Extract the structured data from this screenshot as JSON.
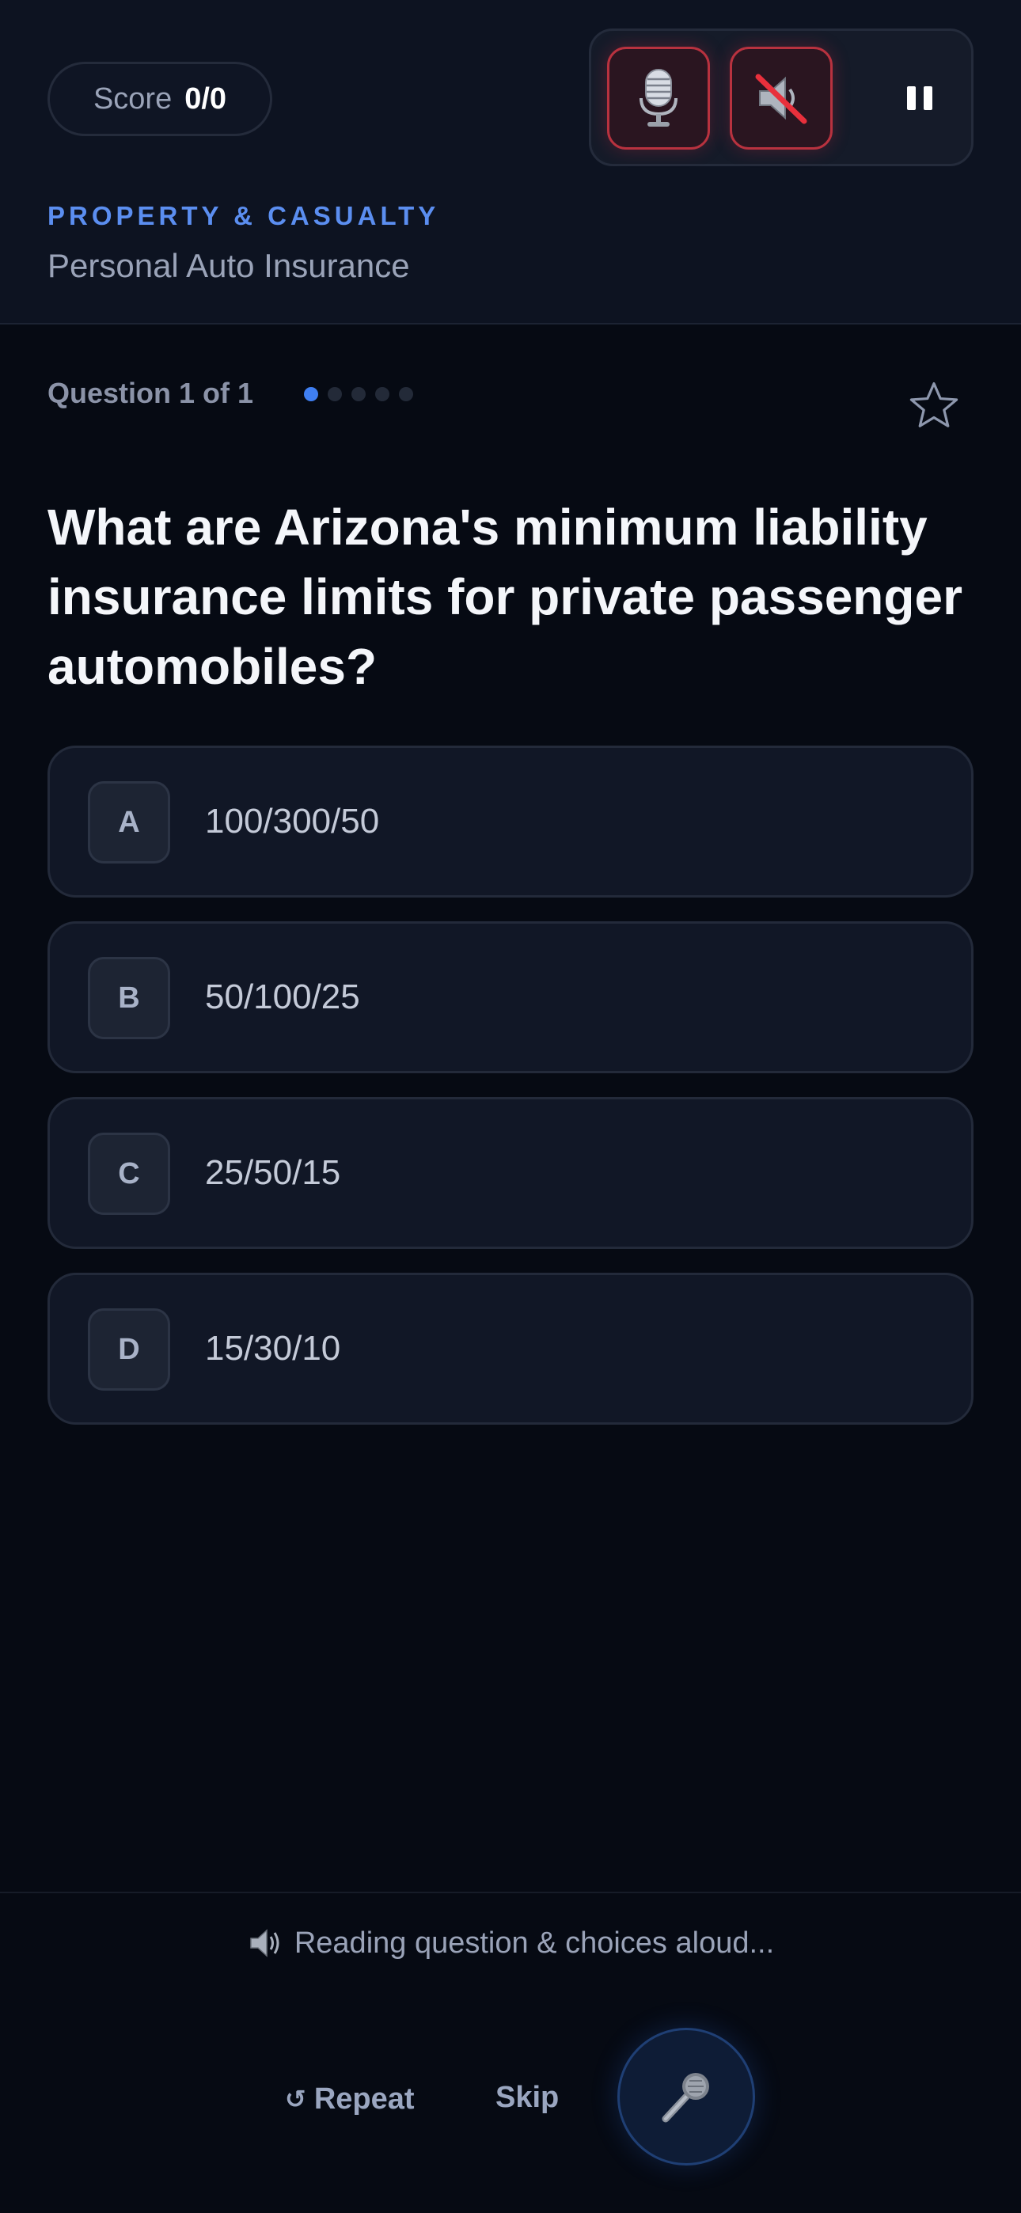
{
  "header": {
    "score_label": "Score",
    "score_value": "0/0",
    "category": "PROPERTY & CASUALTY",
    "subcategory": "Personal Auto Insurance",
    "controls": {
      "mic_icon": "studio-microphone-icon",
      "speaker_icon": "speaker-muted-icon",
      "pause_icon": "pause-icon"
    }
  },
  "progress": {
    "counter": "Question 1 of 1",
    "dots_total": 5,
    "dots_active": 1
  },
  "question": {
    "text": "What are Arizona's minimum liability insurance limits for private passenger automobiles?",
    "bookmark_icon": "star-outline-icon"
  },
  "choices": [
    {
      "letter": "A",
      "text": "100/300/50"
    },
    {
      "letter": "B",
      "text": "50/100/25"
    },
    {
      "letter": "C",
      "text": "25/50/15"
    },
    {
      "letter": "D",
      "text": "15/30/10"
    }
  ],
  "footer": {
    "status_text": "Reading question & choices aloud...",
    "status_icon": "speaker-icon",
    "repeat_glyph": "↺",
    "repeat_label": "Repeat",
    "skip_label": "Skip",
    "mic_icon": "microphone-icon"
  },
  "colors": {
    "background": "#060a13",
    "header_bg": "#0d1321",
    "accent_blue": "#5b8ef0",
    "danger_red": "#b8323f",
    "card_bg": "#111726"
  }
}
